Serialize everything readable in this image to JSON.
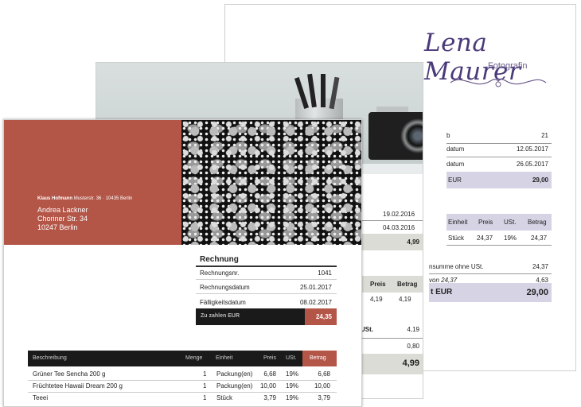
{
  "page3": {
    "logo": "Lena Maurer",
    "subtitle": "Fotografin",
    "rows": [
      {
        "label": "b",
        "value": "21"
      },
      {
        "label": "datum",
        "value": "12.05.2017"
      },
      {
        "label": "datum",
        "value": "26.05.2017"
      }
    ],
    "total_label": "EUR",
    "total_value": "29,00",
    "table_headers": [
      "Einheit",
      "Preis",
      "USt.",
      "Betrag"
    ],
    "table_row": [
      "Stück",
      "24,37",
      "19%",
      "24,37"
    ],
    "sum_label": "nsumme ohne USt.",
    "sum_value": "24,37",
    "vat_label": "von 24,37",
    "vat_value": "4,63",
    "grand_label": "t EUR",
    "grand_value": "29,00"
  },
  "page2": {
    "rows": [
      {
        "value": "19.02.2016"
      },
      {
        "value": "04.03.2016"
      }
    ],
    "total_value": "4,99",
    "headers": [
      "Preis",
      "Betrag"
    ],
    "item": [
      "4,19",
      "4,19"
    ],
    "ust_label": "USt.",
    "ust_value": "4,19",
    "val2": "0,80",
    "grand_value": "4,99"
  },
  "page1": {
    "sender_name": "Klaus Hofmann",
    "sender_rest": "Musterstr. 36 · 10435 Berlin",
    "recipient": [
      "Andrea Lackner",
      "Choriner Str. 34",
      "10247 Berlin"
    ],
    "title": "Rechnung",
    "meta": [
      {
        "label": "Rechnungsnr.",
        "value": "1041"
      },
      {
        "label": "Rechnungsdatum",
        "value": "25.01.2017"
      },
      {
        "label": "Fälligkeitsdatum",
        "value": "08.02.2017"
      }
    ],
    "due_label": "Zu zahlen EUR",
    "due_value": "24,35",
    "table_headers": [
      "Beschreibung",
      "Menge",
      "Einheit",
      "Preis",
      "USt.",
      "Betrag"
    ],
    "items": [
      [
        "Grüner Tee Sencha 200 g",
        "1",
        "Packung(en)",
        "6,68",
        "19%",
        "6,68"
      ],
      [
        "Früchtetee Hawaii Dream 200 g",
        "1",
        "Packung(en)",
        "10,00",
        "19%",
        "10,00"
      ],
      [
        "Teeei",
        "1",
        "Stück",
        "3,79",
        "19%",
        "3,79"
      ]
    ]
  },
  "colors": {
    "brand_red": "#b35648",
    "dark": "#1a1a1a",
    "lavender": "#d6d3e4",
    "grey_band": "#dcdcd6"
  }
}
